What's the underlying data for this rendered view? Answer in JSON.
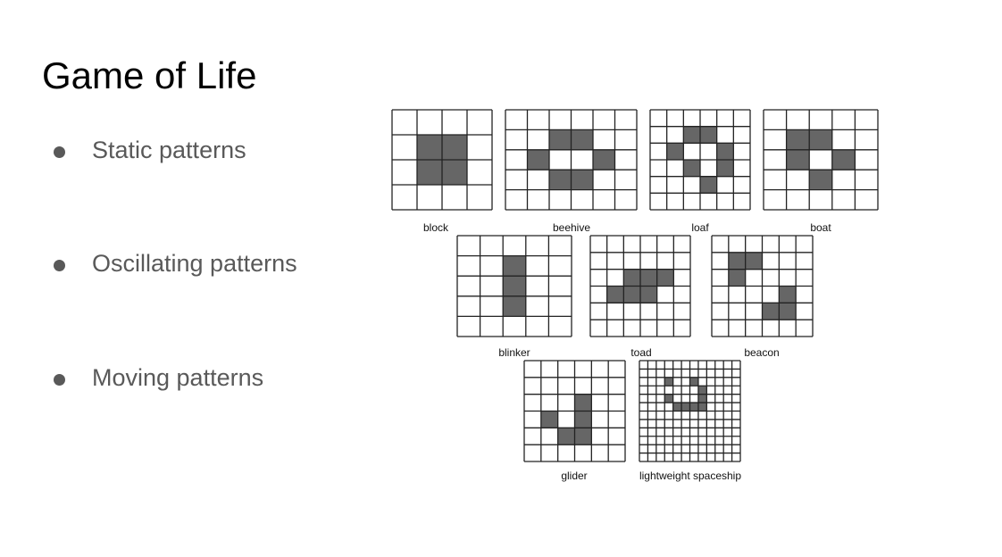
{
  "title": "Game of Life",
  "bullets": [
    "Static patterns",
    "Oscillating patterns",
    "Moving patterns"
  ],
  "colors": {
    "cell_fill": "#666666",
    "grid_line": "#222222",
    "text_gray": "#595959"
  },
  "patterns": [
    {
      "id": "block",
      "label": "block",
      "cols": 4,
      "rows": 4,
      "alive": [
        [
          1,
          1
        ],
        [
          2,
          1
        ],
        [
          1,
          2
        ],
        [
          2,
          2
        ]
      ]
    },
    {
      "id": "beehive",
      "label": "beehive",
      "cols": 6,
      "rows": 5,
      "alive": [
        [
          2,
          1
        ],
        [
          3,
          1
        ],
        [
          1,
          2
        ],
        [
          4,
          2
        ],
        [
          2,
          3
        ],
        [
          3,
          3
        ]
      ]
    },
    {
      "id": "loaf",
      "label": "loaf",
      "cols": 6,
      "rows": 6,
      "alive": [
        [
          2,
          1
        ],
        [
          3,
          1
        ],
        [
          1,
          2
        ],
        [
          4,
          2
        ],
        [
          2,
          3
        ],
        [
          4,
          3
        ],
        [
          3,
          4
        ]
      ]
    },
    {
      "id": "boat",
      "label": "boat",
      "cols": 5,
      "rows": 5,
      "alive": [
        [
          1,
          1
        ],
        [
          2,
          1
        ],
        [
          1,
          2
        ],
        [
          3,
          2
        ],
        [
          2,
          3
        ]
      ]
    },
    {
      "id": "blinker",
      "label": "blinker",
      "cols": 5,
      "rows": 5,
      "alive": [
        [
          2,
          1
        ],
        [
          2,
          2
        ],
        [
          2,
          3
        ]
      ]
    },
    {
      "id": "toad",
      "label": "toad",
      "cols": 6,
      "rows": 6,
      "alive": [
        [
          2,
          2
        ],
        [
          3,
          2
        ],
        [
          4,
          2
        ],
        [
          1,
          3
        ],
        [
          2,
          3
        ],
        [
          3,
          3
        ]
      ]
    },
    {
      "id": "beacon",
      "label": "beacon",
      "cols": 6,
      "rows": 6,
      "alive": [
        [
          1,
          1
        ],
        [
          2,
          1
        ],
        [
          1,
          2
        ],
        [
          4,
          3
        ],
        [
          3,
          4
        ],
        [
          4,
          4
        ]
      ]
    },
    {
      "id": "glider",
      "label": "glider",
      "cols": 6,
      "rows": 6,
      "alive": [
        [
          3,
          2
        ],
        [
          1,
          3
        ],
        [
          3,
          3
        ],
        [
          2,
          4
        ],
        [
          3,
          4
        ]
      ]
    },
    {
      "id": "lightweight-spaceship",
      "label": "lightweight spaceship",
      "cols": 12,
      "rows": 12,
      "alive": [
        [
          3,
          2
        ],
        [
          6,
          2
        ],
        [
          7,
          3
        ],
        [
          3,
          4
        ],
        [
          7,
          4
        ],
        [
          4,
          5
        ],
        [
          5,
          5
        ],
        [
          6,
          5
        ],
        [
          7,
          5
        ]
      ]
    }
  ]
}
